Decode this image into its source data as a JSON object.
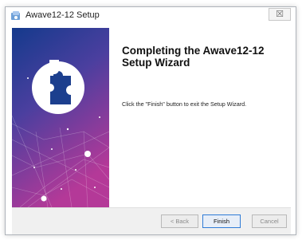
{
  "window": {
    "title": "Awave12-12 Setup",
    "close_glyph": "☒"
  },
  "main": {
    "heading": "Completing the Awave12-12 Setup Wizard",
    "body": "Click the \"Finish\" button to exit the Setup Wizard."
  },
  "buttons": {
    "back": "< Back",
    "finish": "Finish",
    "cancel": "Cancel"
  },
  "icons": {
    "app": "installer-icon",
    "banner": "puzzle-piece-icon"
  },
  "colors": {
    "banner_top": "#163d8c",
    "banner_bottom": "#b53a9a",
    "finish_border": "#2f7bd6"
  }
}
